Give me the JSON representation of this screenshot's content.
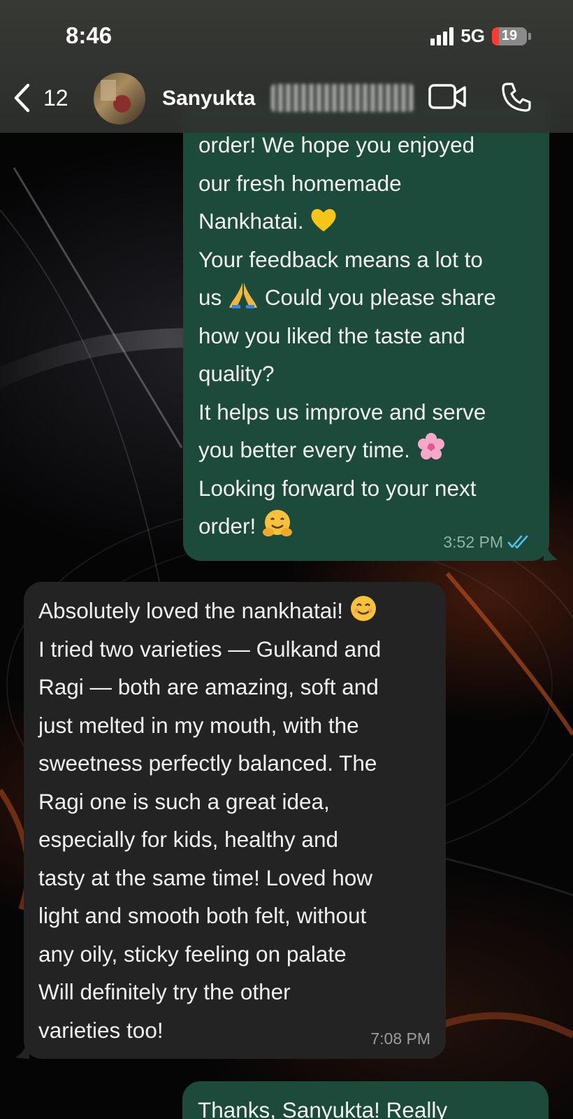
{
  "status_bar": {
    "time": "8:46",
    "network": "5G",
    "battery": "19",
    "battery_level_percent": 19
  },
  "header": {
    "back_count": "12",
    "contact_name": "Sanyukta"
  },
  "messages": [
    {
      "direction": "outgoing",
      "lines": [
        "order! We hope you enjoyed",
        "our fresh homemade",
        "Nankhatai.",
        "Your feedback means a lot to",
        "us",
        "Could you please share",
        "how you liked the taste and",
        "quality?",
        "It helps us improve and serve",
        "you better every time.",
        "Looking forward to your next",
        "order!"
      ],
      "time": "3:52 PM",
      "status": "read"
    },
    {
      "direction": "incoming",
      "lines": [
        "Absolutely loved the nankhatai!",
        "I tried two varieties — Gulkand and",
        "Ragi — both are amazing, soft and",
        "just melted in my mouth, with the",
        "sweetness perfectly balanced. The",
        "Ragi one is such a great idea,",
        "especially for kids, healthy and",
        "tasty at the same time! Loved how",
        "light and smooth both felt, without",
        "any oily, sticky feeling on palate",
        "Will definitely try the other",
        "varieties too!"
      ],
      "time": "7:08 PM"
    },
    {
      "direction": "outgoing",
      "lines": [
        "Thanks, Sanyukta! Really"
      ]
    }
  ],
  "emojis": {
    "yellow_heart": "yellow-heart-icon",
    "folded_hands": "folded-hands-icon",
    "blossom": "cherry-blossom-icon",
    "hug": "hugging-face-icon",
    "smile": "smiling-face-icon"
  },
  "colors": {
    "outgoing_bubble": "#1c4b3b",
    "incoming_bubble": "#232323",
    "read_ticks": "#53bdeb",
    "battery_low": "#ff3b30"
  }
}
